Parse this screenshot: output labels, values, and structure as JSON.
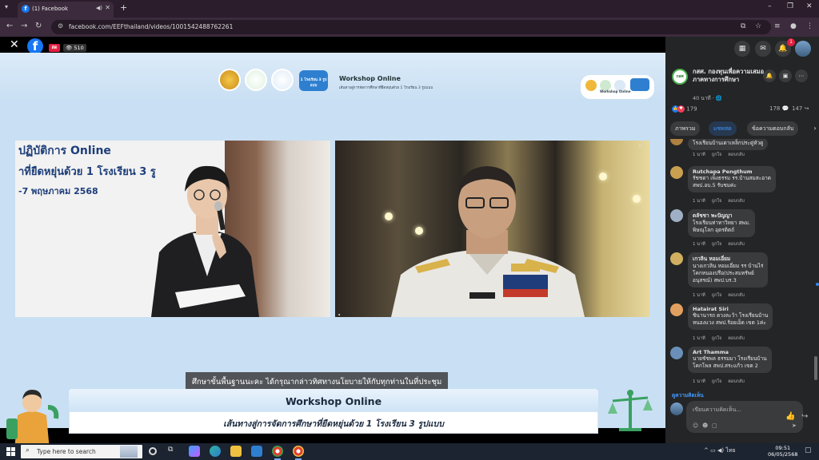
{
  "browser": {
    "tab_title": "(1) Facebook",
    "url": "facebook.com/EEFthailand/videos/1001542488762261",
    "new_tab": "+",
    "win_min": "–",
    "win_max": "❐",
    "win_close": "✕"
  },
  "viewer": {
    "live_badge": "สด",
    "viewer_count": "510"
  },
  "slide": {
    "title": "Workshop Online",
    "subtitle": "เส้นทางสู่การจัดการศึกษาที่ยืดหยุ่นด้วย 1 โรงเรียน 3 รูปแบบ",
    "badge_text": "Workshop Online",
    "left_panel_lines": [
      "ปฏิบัติการ Online",
      "าที่ยืดหยุ่นด้วย 1 โรงเรียน 3 รู",
      "-7 พฤษภาคม 2568"
    ],
    "logo_text_3": "1 โรงเรียน 3 รูปแบบ",
    "caption": "ศึกษาขั้นพื้นฐานนะคะ ได้กรุณากล่าวทิศทางนโยบายให้กับทุกท่านในที่ประชุม",
    "banner_title": "Workshop Online",
    "banner_subtitle": "เส้นทางสู่การจัดการศึกษาที่ยืดหยุ่นด้วย 1 โรงเรียน 3 รูปแบบ"
  },
  "side": {
    "notifications_count": "1",
    "page_name": "กสศ. กองทุนเพื่อความเสมอภาคทางการศึกษา",
    "page_avatar_text": "กสศ",
    "live_status": "40 นาที · ",
    "reaction_count": "179",
    "comment_count": "178",
    "share_count": "147",
    "tabs": [
      "ภาพรวม",
      "แชทสด",
      "ข้อความตอบกลับ"
    ],
    "comments": [
      {
        "name": "",
        "lines": [
          "โรงเรียนบ้านเตาเหล็กประดู่หัวดู"
        ],
        "time": "1 นาที",
        "like": "ถูกใจ",
        "reply": "ตอบกลับ"
      },
      {
        "name": "Rutchapa Pengthum",
        "lines": [
          "รัชชดา เพ็งธรรม รร.บ้านสมสะอาด",
          "สพป.อบ.5 รับชมค่ะ"
        ],
        "time": "1 นาที",
        "like": "ถูกใจ",
        "reply": "ตอบกลับ"
      },
      {
        "name": "ดลัชชา พะปัญญา",
        "lines": [
          "โรงเรียนท่าทาวิทยา สพม.",
          "พิษณุโลก อุตรดิตถ์"
        ],
        "time": "1 นาที",
        "like": "ถูกใจ",
        "reply": "ตอบกลับ"
      },
      {
        "name": "เกวลิน หอมเอี่ยม",
        "lines": [
          "นางเกวลิน หอมเอี่ยม รร บ้านไร่",
          "โคกหนองปรือ(ประสมทรัพย์",
          "อนุสรณ์) สพป.บร.3"
        ],
        "time": "1 นาที",
        "like": "ถูกใจ",
        "reply": "ตอบกลับ"
      },
      {
        "name": "Hatairat Siri",
        "lines": [
          "ชินานารถ ดวงละว้า โรงเรียนบ้าน",
          "หนองแวง สพป.ร้อยเอ็ด เขต 1ค่ะ"
        ],
        "time": "1 นาที",
        "like": "ถูกใจ",
        "reply": "ตอบกลับ"
      },
      {
        "name": "Art Thamma",
        "lines": [
          "นายชัชพล ธรรมมา โรงเรียนบ้าน",
          "โคกโพล สพป.สระแก้ว เขต 2"
        ],
        "time": "1 นาที",
        "like": "ถูกใจ",
        "reply": "ตอบกลับ"
      }
    ],
    "more_comments": "ดูความคิดเห็น",
    "input_placeholder": "เขียนความคิดเห็น..."
  },
  "taskbar": {
    "search_placeholder": "Type here to search",
    "lang": "ไทย",
    "time": "09:51",
    "date": "06/05/2568"
  },
  "colors": {
    "facebook_blue": "#1877f2",
    "live_red": "#e41e3f",
    "slide_bg": "#c9dff3",
    "panel_dark": "#242526"
  }
}
